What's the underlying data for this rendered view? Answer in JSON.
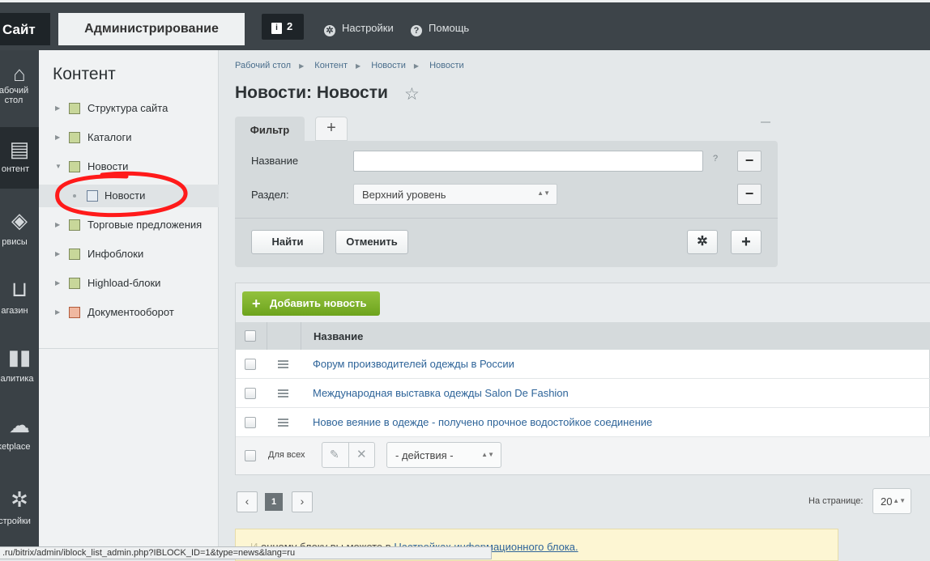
{
  "topbar": {
    "site_tab": "Сайт",
    "admin_tab": "Администрирование",
    "notifications_count": "2",
    "settings_label": "Настройки",
    "help_label": "Помощь"
  },
  "leftbar": {
    "items": [
      {
        "label": "абочий стол",
        "icon": "home-icon"
      },
      {
        "label": "онтент",
        "icon": "content-icon"
      },
      {
        "label": "рвисы",
        "icon": "services-icon"
      },
      {
        "label": "агазин",
        "icon": "basket-icon"
      },
      {
        "label": "налитика",
        "icon": "analytics-icon"
      },
      {
        "label": "ketplace",
        "icon": "marketplace-icon"
      },
      {
        "label": "стройки",
        "icon": "gear-icon"
      }
    ]
  },
  "sidemenu": {
    "title": "Контент",
    "items": [
      {
        "label": "Структура сайта"
      },
      {
        "label": "Каталоги"
      },
      {
        "label": "Новости"
      },
      {
        "label": "Новости"
      },
      {
        "label": "Торговые предложения"
      },
      {
        "label": "Инфоблоки"
      },
      {
        "label": "Highload-блоки"
      },
      {
        "label": "Документооборот"
      }
    ]
  },
  "breadcrumb": [
    "Рабочий стол",
    "Контент",
    "Новости",
    "Новости"
  ],
  "page": {
    "title": "Новости: Новости"
  },
  "filter": {
    "tab_label": "Фильтр",
    "add_tab": "+",
    "name_label": "Название",
    "name_value": "",
    "help_mark": "?",
    "section_label": "Раздел:",
    "section_value": "Верхний уровень",
    "find_button": "Найти",
    "cancel_button": "Отменить"
  },
  "list": {
    "add_button": "Добавить новость",
    "column_name": "Название",
    "rows": [
      {
        "name": "Форум производителей одежды в России"
      },
      {
        "name": "Международная выставка одежды Salon De Fashion"
      },
      {
        "name": "Новое веяние в одежде - получено прочное водостойкое соединение"
      }
    ],
    "for_all": "Для всех",
    "actions_select": "- действия -"
  },
  "pagination": {
    "prev": "‹",
    "current": "1",
    "next": "›",
    "per_page_label": "На странице:",
    "per_page_value": "20"
  },
  "note": {
    "text_visible": "онному блоку вы можете в",
    "link": "Настройках информационного блока."
  },
  "statusbar": {
    "url": ".ru/bitrix/admin/iblock_list_admin.php?IBLOCK_ID=1&type=news&lang=ru"
  },
  "colors": {
    "accent_green": "#7cb227",
    "link_blue": "#2e6499",
    "annotation_red": "#ff1a1a"
  }
}
